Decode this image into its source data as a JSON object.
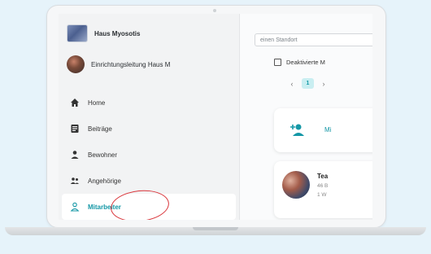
{
  "sidebar": {
    "org_name": "Haus Myosotis",
    "user_role": "Einrichtungsleitung Haus M",
    "items": [
      {
        "label": "Home",
        "icon": "home-icon"
      },
      {
        "label": "Beiträge",
        "icon": "posts-icon"
      },
      {
        "label": "Bewohner",
        "icon": "resident-icon"
      },
      {
        "label": "Angehörige",
        "icon": "relatives-icon"
      },
      {
        "label": "Mitarbeiter",
        "icon": "staff-icon",
        "active": true
      }
    ]
  },
  "main": {
    "location_placeholder": "einen Standort",
    "deactivated_label": "Deaktivierte M",
    "pagination": {
      "current": "1",
      "prev": "‹",
      "next": "›"
    },
    "add_card_label": "Mi",
    "team_card": {
      "title": "Tea",
      "line1": "46 B",
      "line2": "1 W"
    }
  },
  "colors": {
    "accent": "#1497a6",
    "annotation": "#d9353a",
    "background": "#e6f3fa"
  }
}
